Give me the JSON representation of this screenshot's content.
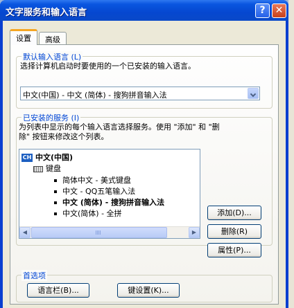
{
  "window": {
    "title": "文字服务和输入语言",
    "help_label": "?",
    "close_label": "✕"
  },
  "tabs": [
    {
      "label": "设置",
      "active": true
    },
    {
      "label": "高级",
      "active": false
    }
  ],
  "default_language": {
    "group_title": "默认输入语言 (L)",
    "description": "选择计算机启动时要使用的一个已安装的输入语言。",
    "selected_value": "中文(中国) - 中文 (简体) - 搜狗拼音输入法"
  },
  "installed_services": {
    "group_title": "已安装的服务 (I)",
    "description_line1": "为列表中显示的每个输入语言选择服务。使用 \"添加\" 和 \"删",
    "description_line2": "除\" 按钮来修改这个列表。",
    "tree": {
      "language_badge": "CH",
      "language": "中文(中国)",
      "category": "键盘",
      "items": [
        {
          "label": "简体中文 - 美式键盘",
          "bold": false
        },
        {
          "label": "中文 - QQ五笔输入法",
          "bold": false
        },
        {
          "label": "中文 (简体) - 搜狗拼音输入法",
          "bold": true
        },
        {
          "label": "中文(简体) - 全拼",
          "bold": false
        }
      ]
    },
    "buttons": {
      "add": "添加(D)...",
      "remove": "删除(R)",
      "properties": "属性(P)..."
    }
  },
  "preferences": {
    "group_title": "首选项",
    "language_bar": "语言栏(B)...",
    "key_settings": "键设置(K)..."
  },
  "scrollbar": {
    "left_arrow": "◀",
    "right_arrow": "▶"
  }
}
